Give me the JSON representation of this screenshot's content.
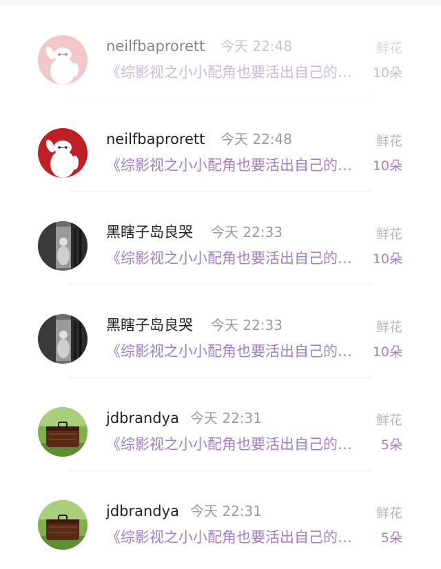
{
  "colors": {
    "accent": "#a47dc6",
    "muted": "#9a9a9a",
    "name": "#222222"
  },
  "records": [
    {
      "name": "neilfbaprorett",
      "time": "今天 22:48",
      "desc": "《综影视之小小配角也要活出自己的…",
      "gift": "鲜花",
      "count": "10朵",
      "avatar_icon": "baymax-avatar-icon"
    },
    {
      "name": "neilfbaprorett",
      "time": "今天 22:48",
      "desc": "《综影视之小小配角也要活出自己的…",
      "gift": "鲜花",
      "count": "10朵",
      "avatar_icon": "baymax-avatar-icon"
    },
    {
      "name": "黑瞎子岛良哭",
      "time": "今天 22:33",
      "desc": "《综影视之小小配角也要活出自己的…",
      "gift": "鲜花",
      "count": "10朵",
      "avatar_icon": "grayscale-photo-avatar-icon"
    },
    {
      "name": "黑瞎子岛良哭",
      "time": "今天 22:33",
      "desc": "《综影视之小小配角也要活出自己的…",
      "gift": "鲜花",
      "count": "10朵",
      "avatar_icon": "grayscale-photo-avatar-icon"
    },
    {
      "name": "jdbrandya",
      "time": "今天 22:31",
      "desc": "《综影视之小小配角也要活出自己的…",
      "gift": "鲜花",
      "count": "5朵",
      "avatar_icon": "suitcase-on-grass-avatar-icon"
    },
    {
      "name": "jdbrandya",
      "time": "今天 22:31",
      "desc": "《综影视之小小配角也要活出自己的…",
      "gift": "鲜花",
      "count": "5朵",
      "avatar_icon": "suitcase-on-grass-avatar-icon"
    }
  ]
}
